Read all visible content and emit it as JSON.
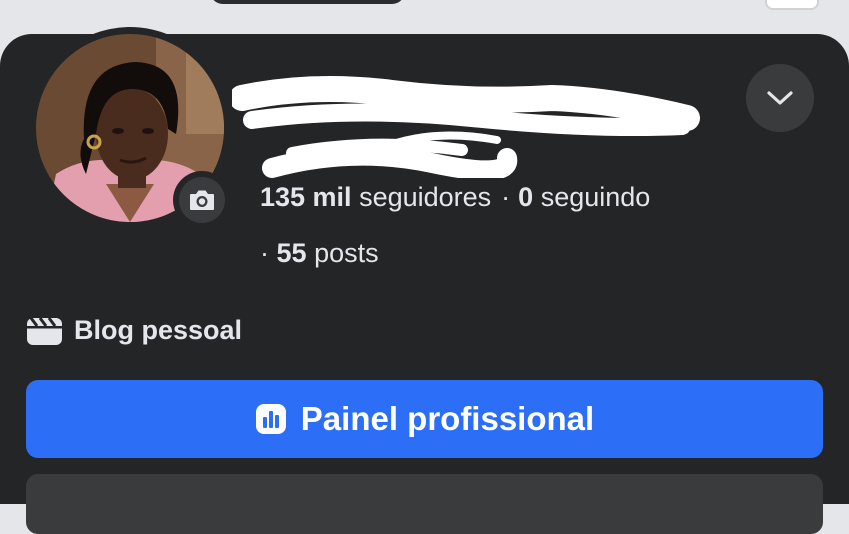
{
  "profile": {
    "followers_count": "135 mil",
    "followers_label": "seguidores",
    "following_count": "0",
    "following_label": "seguindo",
    "posts_count": "55",
    "posts_label": "posts",
    "separator": "·",
    "category": "Blog pessoal"
  },
  "actions": {
    "professional_dashboard": "Painel profissional"
  },
  "icons": {
    "camera": "camera-icon",
    "chevron": "chevron-down-icon",
    "category": "clapperboard-icon",
    "dashboard": "bar-chart-icon"
  },
  "colors": {
    "card_background": "#242527",
    "primary_button": "#2d6ef7",
    "text": "#e4e6eb",
    "secondary_button": "#3a3b3d"
  }
}
